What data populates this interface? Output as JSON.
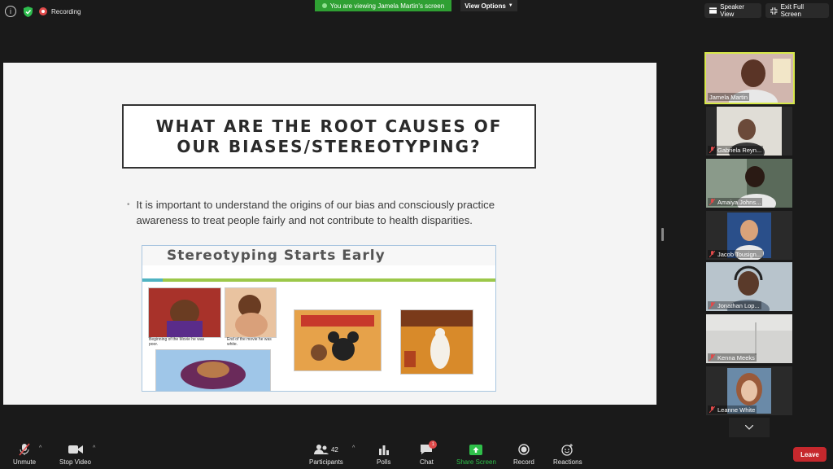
{
  "top": {
    "recording_label": "Recording",
    "viewing_banner": "You are viewing Jamela Martin's screen",
    "view_options": "View Options",
    "speaker_view": "Speaker View",
    "exit_full_screen": "Exit Full Screen"
  },
  "slide": {
    "title": "WHAT ARE THE ROOT CAUSES OF\nOUR BIASES/STEREOTYPING?",
    "bullet": "It is important to understand the origins of our bias and consciously practice awareness to treat people fairly and not contribute to health disparities.",
    "inset_title": "Stereotyping Starts Early",
    "caption_1": "Beginning of the Movie he was poor.",
    "caption_2": "End of the movie he was white."
  },
  "participants": [
    {
      "name": "Jamela Martin",
      "active": true,
      "muted": false,
      "color": "#c8a8a0"
    },
    {
      "name": "Gabriela Reyn...",
      "active": false,
      "muted": true,
      "color": "#6b5a52"
    },
    {
      "name": "Amaiya Johns...",
      "active": false,
      "muted": true,
      "color": "#7a8a6a"
    },
    {
      "name": "Jacob Tousign...",
      "active": false,
      "muted": true,
      "color": "#2a4f8a"
    },
    {
      "name": "Jonathan Lop...",
      "active": false,
      "muted": true,
      "color": "#8a9ab0"
    },
    {
      "name": "Kenna Meeks",
      "active": false,
      "muted": true,
      "color": "#cfcfcf"
    },
    {
      "name": "Leanne White",
      "active": false,
      "muted": true,
      "color": "#b07a5a"
    }
  ],
  "toolbar": {
    "unmute": "Unmute",
    "stop_video": "Stop Video",
    "participants": "Participants",
    "participants_count": "42",
    "polls": "Polls",
    "chat": "Chat",
    "chat_badge": "1",
    "share_screen": "Share Screen",
    "record": "Record",
    "reactions": "Reactions",
    "leave": "Leave"
  },
  "colors": {
    "accent_green": "#2fa033",
    "leave_red": "#c6282d",
    "active_border": "#d7e84a"
  }
}
